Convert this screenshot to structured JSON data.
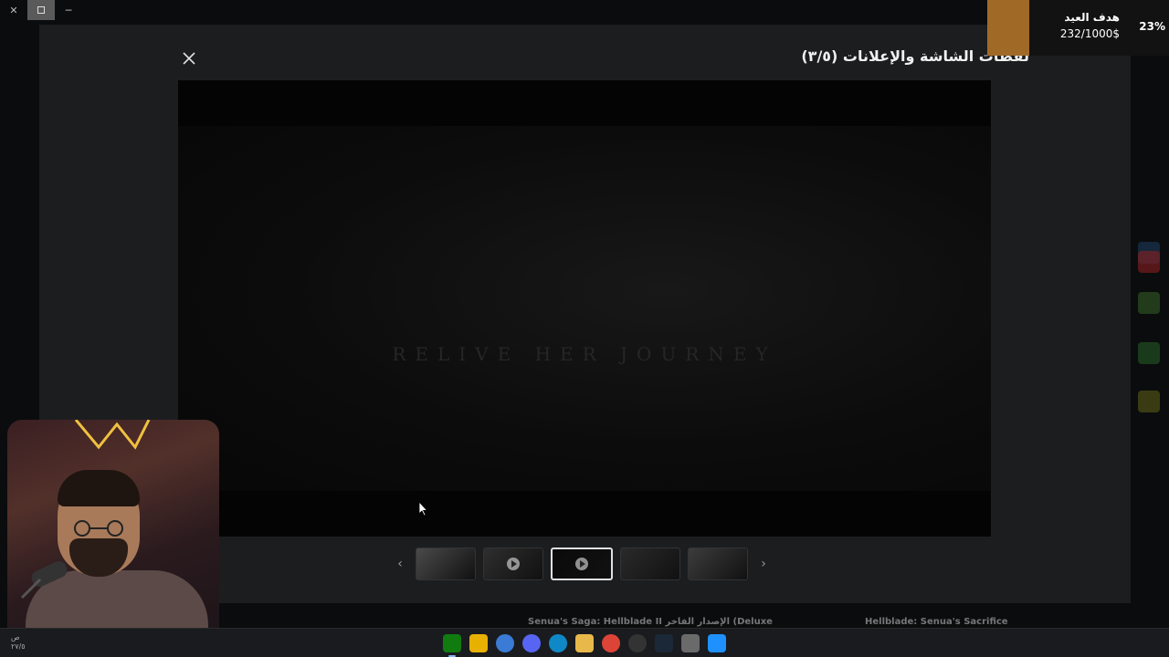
{
  "modal": {
    "title": "لقطات الشاشة والإعلانات (٣/٥)",
    "video_overlay_text": "RELIVE HER JOURNEY"
  },
  "thumbnails": [
    {
      "label": "thumb-1",
      "video": false,
      "selected": false,
      "color": "#4a4a4a"
    },
    {
      "label": "thumb-2",
      "video": true,
      "selected": false,
      "color": "#2e2e2e"
    },
    {
      "label": "thumb-3",
      "video": true,
      "selected": true,
      "color": "#0a0a0a"
    },
    {
      "label": "thumb-4",
      "video": false,
      "selected": false,
      "color": "#2a2a2a"
    },
    {
      "label": "thumb-5",
      "video": false,
      "selected": false,
      "color": "#3c3c3c"
    }
  ],
  "goal": {
    "title": "هدف العيد",
    "amount": "232/1000$",
    "percent": "23%",
    "fraction": 0.23
  },
  "bottom": {
    "left_title": "Senua's Saga: Hellblade II الإصدار الفاخر (Deluxe",
    "right_title": "Hellblade: Senua's Sacrifice"
  },
  "clock": {
    "line1": "ص",
    "line2": "٢٧/٥"
  },
  "taskbar_icons": [
    "xbox-icon",
    "rockstar-icon",
    "copilot-icon",
    "discord-icon",
    "edge-icon",
    "file-explorer-icon",
    "chrome-icon",
    "obs-icon",
    "steam-icon",
    "settings-icon",
    "windows-store-icon"
  ]
}
